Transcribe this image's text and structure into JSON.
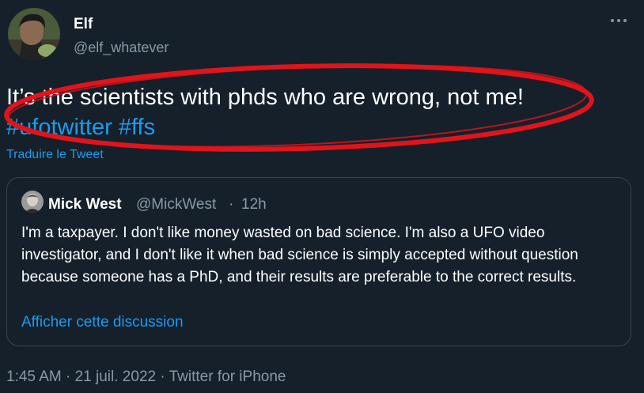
{
  "author": {
    "name": "Elf",
    "handle": "@elf_whatever"
  },
  "more_icon": "more-horizontal-icon",
  "tweet": {
    "text": "It’s the scientists with phds who are wrong, not me!",
    "hashtags": [
      "#ufotwitter",
      "#ffs"
    ],
    "translate_label": "Traduire le Tweet"
  },
  "quoted": {
    "name": "Mick West",
    "handle": "@MickWest",
    "separator": "·",
    "time": "12h",
    "text": "I'm a taxpayer. I don't like money wasted on bad science. I'm also a UFO video investigator, and I don't like it when bad science is simply accepted without question because someone has a PhD, and their results are preferable to the correct results.",
    "link_label": "Afficher cette discussion"
  },
  "meta": {
    "time": "1:45 AM",
    "separator": "·",
    "date": "21 juil. 2022",
    "source": "Twitter for iPhone"
  },
  "colors": {
    "background": "#15202b",
    "accent": "#1d9bf0",
    "secondary_text": "#8899a6",
    "annotation_red": "#e0141a"
  }
}
